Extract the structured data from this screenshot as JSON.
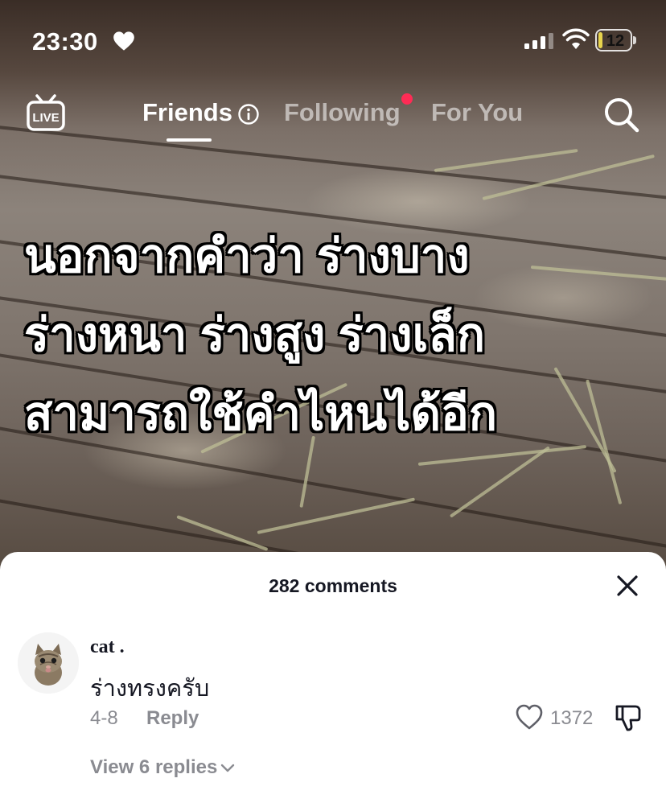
{
  "status_bar": {
    "time": "23:30",
    "battery": "12",
    "battery_level": 0.12
  },
  "nav": {
    "live_label": "LIVE",
    "tabs": [
      {
        "label": "Friends",
        "active": true
      },
      {
        "label": "Following",
        "active": false,
        "has_notification": true
      },
      {
        "label": "For You",
        "active": false
      }
    ]
  },
  "video": {
    "caption_lines": [
      "นอกจากคำว่า ร่างบาง",
      "ร่างหนา ร่างสูง ร่างเล็ก",
      "สามารถใช้คำไหนได้อีก"
    ]
  },
  "comments": {
    "title": "282 comments",
    "items": [
      {
        "username": "cat .",
        "text": "ร่างทรงครับ",
        "date": "4-8",
        "reply_label": "Reply",
        "likes": "1372",
        "view_replies": "View 6 replies"
      }
    ]
  },
  "colors": {
    "accent": "#fe2c55",
    "battery": "#e8d44d",
    "muted_text": "#8a8b91",
    "text": "#161823"
  }
}
